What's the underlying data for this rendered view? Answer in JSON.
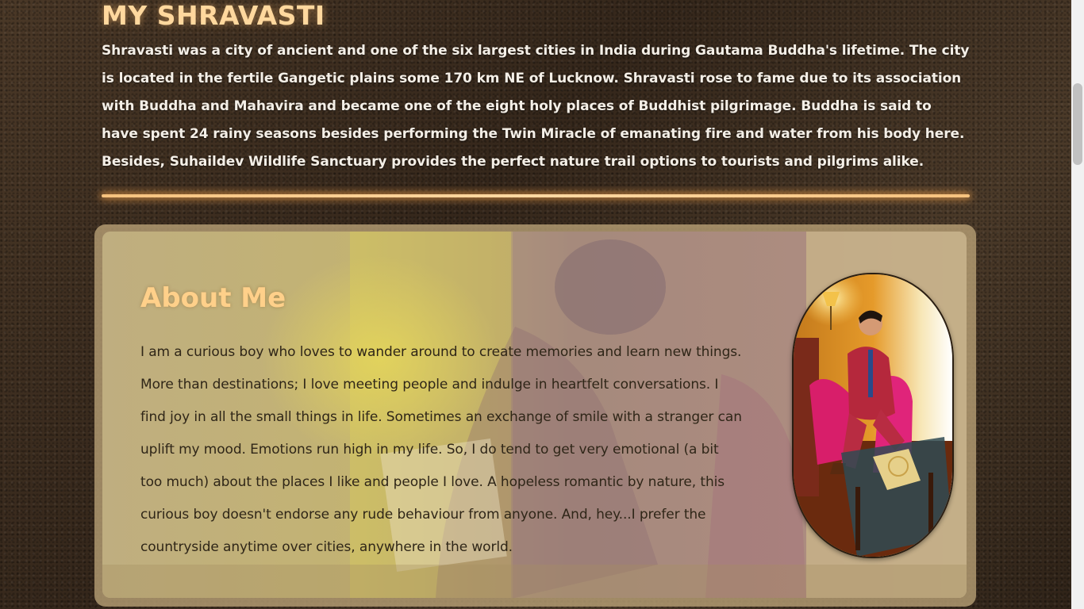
{
  "intro": {
    "title": "MY SHRAVASTI",
    "text": "Shravasti was a city of ancient and one of the six largest cities in India during Gautama Buddha's lifetime. The city is located in the fertile Gangetic plains some 170 km NE of Lucknow. Shravasti rose to fame due to its association with Buddha and Mahavira and became one of the eight holy places of Buddhist pilgrimage. Buddha is said to have spent 24 rainy seasons besides performing the Twin Miracle of emanating fire and water from his body here. Besides, Suhaildev Wildlife Sanctuary provides the perfect nature trail options to tourists and pilgrims alike."
  },
  "about": {
    "title": "About Me",
    "text": "I am a curious boy who loves to wander around to create memories and learn new things. More than destinations; I love meeting people and indulge in heartfelt conversations. I find joy in all the small things in life. Sometimes an exchange of smile with a stranger can uplift my mood. Emotions run high in my life. So, I do tend to get very emotional (a bit too much) about the places I like and people I love. A hopeless romantic by nature, this curious boy doesn't endorse any rude behaviour from anyone. And, hey...I prefer the countryside anytime over cities, anywhere in the world."
  },
  "colors": {
    "title_accent": "#ffd89e",
    "divider_glow": "#f6c27e",
    "card_background": "#b8a47a"
  }
}
